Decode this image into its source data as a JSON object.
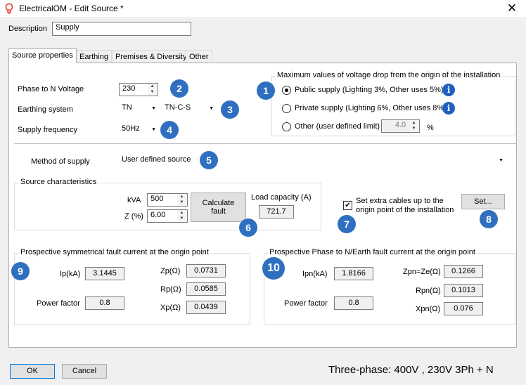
{
  "window": {
    "title": "ElectricalOM - Edit Source *",
    "close": "✕"
  },
  "description": {
    "label": "Description",
    "value": "Supply"
  },
  "tabs": [
    {
      "label": "Source properties"
    },
    {
      "label": "Earthing"
    },
    {
      "label": "Premises & Diversity"
    },
    {
      "label": "Other"
    }
  ],
  "source": {
    "phase_voltage": {
      "label": "Phase to N Voltage",
      "value": "230"
    },
    "earthing": {
      "label": "Earthing system",
      "system": "TN",
      "subsystem": "TN-C-S"
    },
    "frequency": {
      "label": "Supply frequency",
      "value": "50Hz"
    }
  },
  "voltage_drop": {
    "title": "Maximum values of voltage drop from the origin of the installation",
    "options": [
      {
        "label": "Public supply (Lighting 3%, Other uses 5%)",
        "selected": true
      },
      {
        "label": "Private supply (Lighting 6%, Other uses 8%)",
        "selected": false
      },
      {
        "label": "Other (user defined limit)",
        "selected": false
      }
    ],
    "other_value": "4.0",
    "other_unit": "%"
  },
  "method": {
    "label": "Method of supply",
    "value": "User defined source"
  },
  "characteristics": {
    "title": "Source characteristics",
    "kva_label": "kVA",
    "kva_value": "500",
    "z_label": "Z (%)",
    "z_value": "6.00",
    "calc_button": "Calculate fault",
    "load_label": "Load capacity (A)",
    "load_value": "721.7"
  },
  "extra_cables": {
    "label": "Set extra cables up to the origin point of the installation",
    "checked": true,
    "set_button": "Set..."
  },
  "symmetrical": {
    "title": "Prospective symmetrical fault current at the origin point",
    "ip_label": "Ip(kA)",
    "ip_value": "3.1445",
    "pf_label": "Power factor",
    "pf_value": "0.8",
    "zp_label": "Zp(Ω)",
    "zp_value": "0.0731",
    "rp_label": "Rp(Ω)",
    "rp_value": "0.0585",
    "xp_label": "Xp(Ω)",
    "xp_value": "0.0439"
  },
  "phase_to_n": {
    "title": "Prospective Phase to N/Earth fault current at the origin point",
    "ipn_label": "Ipn(kA)",
    "ipn_value": "1.8166",
    "pf_label": "Power factor",
    "pf_value": "0.8",
    "zpn_label": "Zpn=Ze(Ω)",
    "zpn_value": "0.1266",
    "rpn_label": "Rpn(Ω)",
    "rpn_value": "0.1013",
    "xpn_label": "Xpn(Ω)",
    "xpn_value": "0.076"
  },
  "badges": [
    "1",
    "2",
    "3",
    "4",
    "5",
    "6",
    "7",
    "8",
    "9",
    "10"
  ],
  "footer": {
    "ok": "OK",
    "cancel": "Cancel",
    "status": "Three-phase: 400V , 230V 3Ph + N"
  },
  "colors": {
    "badge": "#2f6fc0",
    "info": "#1f5fbd",
    "app_icon": "#e8443a"
  }
}
